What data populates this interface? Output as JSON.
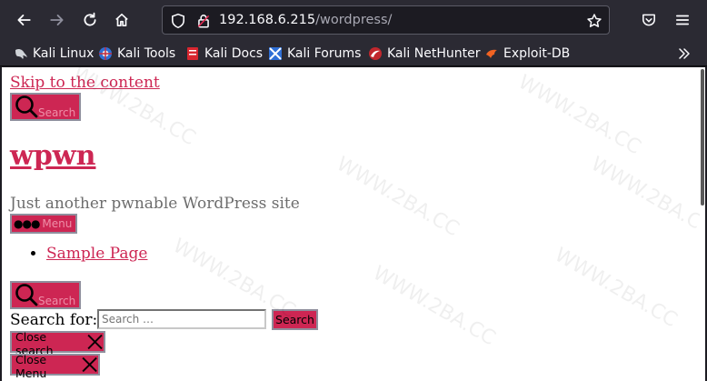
{
  "browser": {
    "url_host": "192.168.6.215",
    "url_path": "/wordpress/",
    "icons": {
      "back": "back-arrow-icon",
      "forward": "forward-arrow-icon",
      "reload": "reload-icon",
      "home": "home-icon",
      "tracking": "shield-icon",
      "lock": "lock-icon",
      "bookmark": "star-icon",
      "pocket": "pocket-icon",
      "menu": "hamburger-icon"
    },
    "bookmarks": [
      {
        "label": "Kali Linux",
        "icon": "kali-dragon-icon"
      },
      {
        "label": "Kali Tools",
        "icon": "kali-tools-icon"
      },
      {
        "label": "Kali Docs",
        "icon": "kali-docs-icon"
      },
      {
        "label": "Kali Forums",
        "icon": "kali-forums-icon"
      },
      {
        "label": "Kali NetHunter",
        "icon": "nethunter-icon"
      },
      {
        "label": "Exploit-DB",
        "icon": "exploit-db-icon"
      }
    ],
    "overflow_icon": "chevron-double-right-icon"
  },
  "page": {
    "skip_link": "Skip to the content",
    "search_toggle_label": "Search",
    "site_title": "wpwn",
    "site_description": "Just another pwnable WordPress site",
    "menu_toggle_label": "Menu",
    "nav_items": [
      "Sample Page"
    ],
    "search_toggle2_label": "Search",
    "search_for_label": "Search for:",
    "search_placeholder": "Search …",
    "search_submit": "Search",
    "close_search": "Close search",
    "close_menu": "Close Menu",
    "watermark_text": "WWW.2BA.CC"
  },
  "colors": {
    "accent": "#cd2653",
    "chrome_bg": "#2b2a33",
    "text": "#6d6d6d"
  }
}
